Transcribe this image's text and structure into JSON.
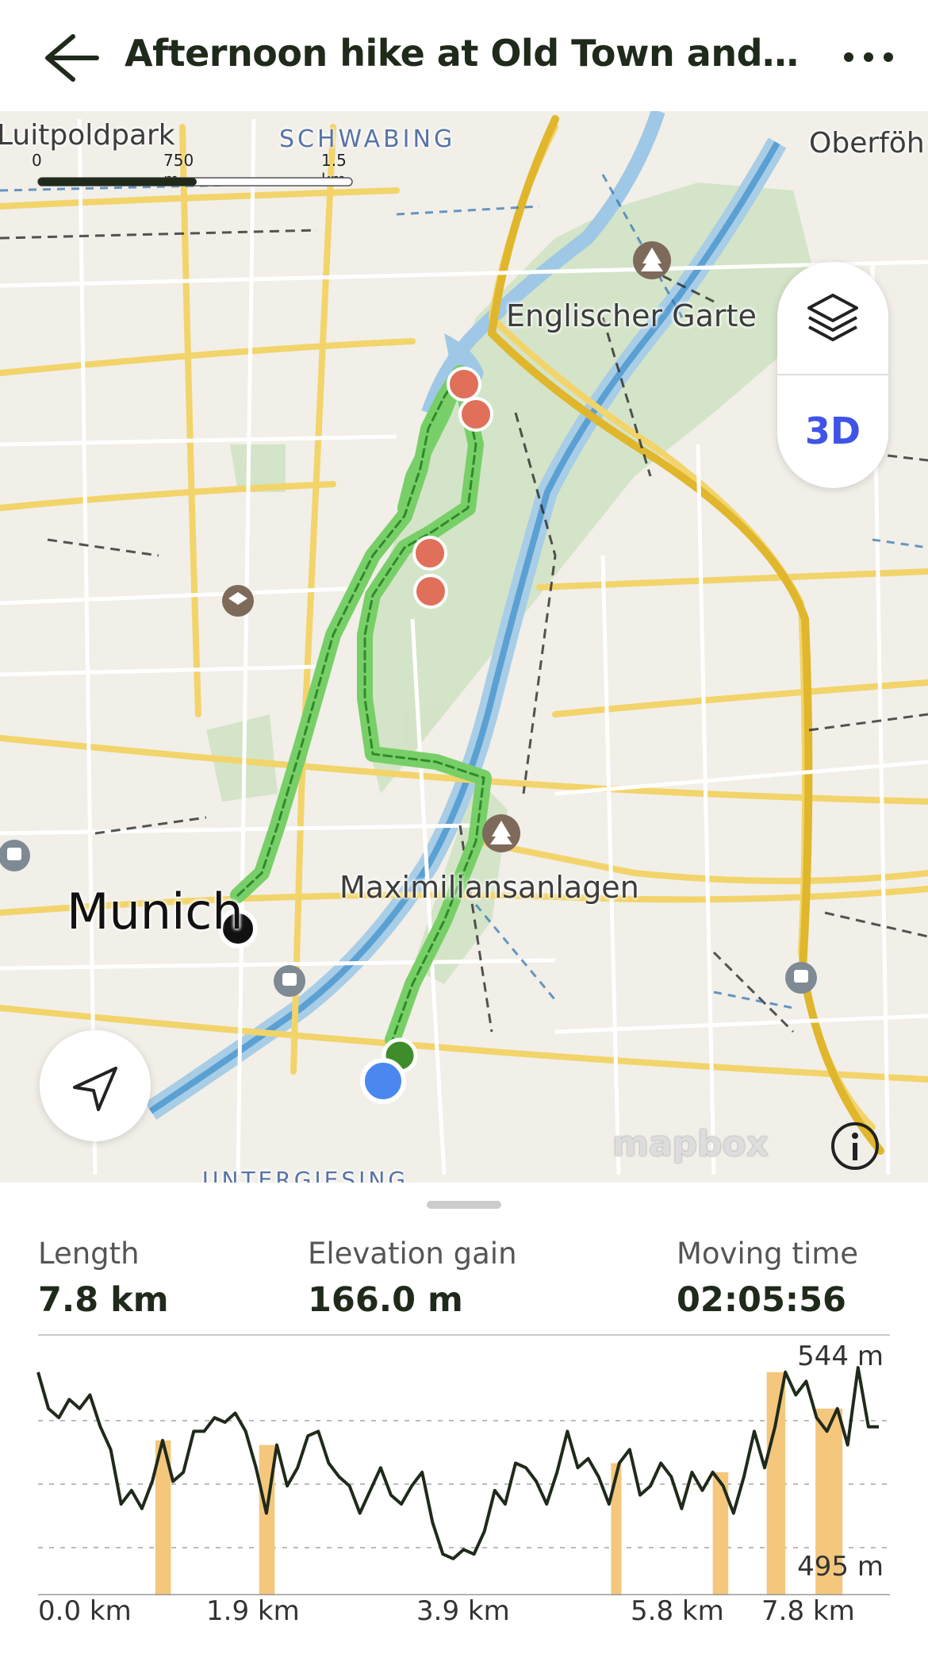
{
  "header": {
    "title": "Afternoon hike at Old Town and Eng..."
  },
  "map": {
    "labels": {
      "luitpoldpark": "Luitpoldpark",
      "schwabing": "SCHWABING",
      "oberfohring": "Oberföh",
      "englischer_garten": "Englischer Garte",
      "maximiliansanlagen": "Maximiliansanlagen",
      "munich": "Munich",
      "untergiesing": "UNTERGIESING"
    },
    "scale": {
      "zero": "0",
      "mid": "750 m",
      "end": "1.5 km"
    },
    "button_3d": "3D",
    "attribution": "mapbox"
  },
  "stats": {
    "length_label": "Length",
    "length_value": "7.8 km",
    "elevation_label": "Elevation gain",
    "elevation_value": "166.0 m",
    "time_label": "Moving time",
    "time_value": "02:05:56"
  },
  "chart_data": {
    "type": "area",
    "title": "",
    "xlabel": "",
    "ylabel": "",
    "x_ticks": [
      "0.0 km",
      "1.9 km",
      "3.9 km",
      "5.8 km",
      "7.8 km"
    ],
    "y_max_label": "544 m",
    "y_min_label": "495 m",
    "ylim": [
      495,
      544
    ],
    "x_km": [
      0.0,
      0.1,
      0.2,
      0.3,
      0.4,
      0.5,
      0.6,
      0.7,
      0.8,
      0.9,
      1.0,
      1.1,
      1.2,
      1.3,
      1.4,
      1.5,
      1.6,
      1.7,
      1.8,
      1.9,
      2.0,
      2.1,
      2.2,
      2.3,
      2.4,
      2.5,
      2.6,
      2.7,
      2.8,
      2.9,
      3.0,
      3.1,
      3.2,
      3.3,
      3.4,
      3.5,
      3.6,
      3.7,
      3.8,
      3.9,
      4.0,
      4.1,
      4.2,
      4.3,
      4.4,
      4.5,
      4.6,
      4.7,
      4.8,
      4.9,
      5.0,
      5.1,
      5.2,
      5.3,
      5.4,
      5.5,
      5.6,
      5.7,
      5.8,
      5.9,
      6.0,
      6.1,
      6.2,
      6.3,
      6.4,
      6.5,
      6.6,
      6.7,
      6.8,
      6.9,
      7.0,
      7.1,
      7.2,
      7.3,
      7.4,
      7.5,
      7.6,
      7.7,
      7.8,
      7.9,
      8.0,
      8.1
    ],
    "elevation_m": [
      543,
      535,
      533,
      537,
      535,
      538,
      531,
      526,
      514,
      517,
      513,
      519,
      528,
      519,
      521,
      530,
      530,
      533,
      532,
      534,
      530,
      522,
      512,
      527,
      518,
      522,
      529,
      530,
      523,
      520,
      518,
      512,
      517,
      522,
      516,
      514,
      518,
      521,
      510,
      503,
      502,
      504,
      503,
      508,
      517,
      514,
      523,
      522,
      519,
      514,
      521,
      530,
      522,
      524,
      520,
      514,
      523,
      526,
      516,
      518,
      523,
      520,
      513,
      521,
      517,
      521,
      518,
      512,
      520,
      530,
      522,
      531,
      543,
      538,
      541,
      533,
      530,
      535,
      527,
      544,
      531,
      531
    ],
    "highlight_ranges_km": [
      [
        1.13,
        1.28
      ],
      [
        2.13,
        2.28
      ],
      [
        5.52,
        5.62
      ],
      [
        6.5,
        6.65
      ],
      [
        7.02,
        7.2
      ],
      [
        7.49,
        7.75
      ]
    ],
    "colors": {
      "line": "#1f2a1b",
      "highlight": "#f4c77d"
    }
  }
}
